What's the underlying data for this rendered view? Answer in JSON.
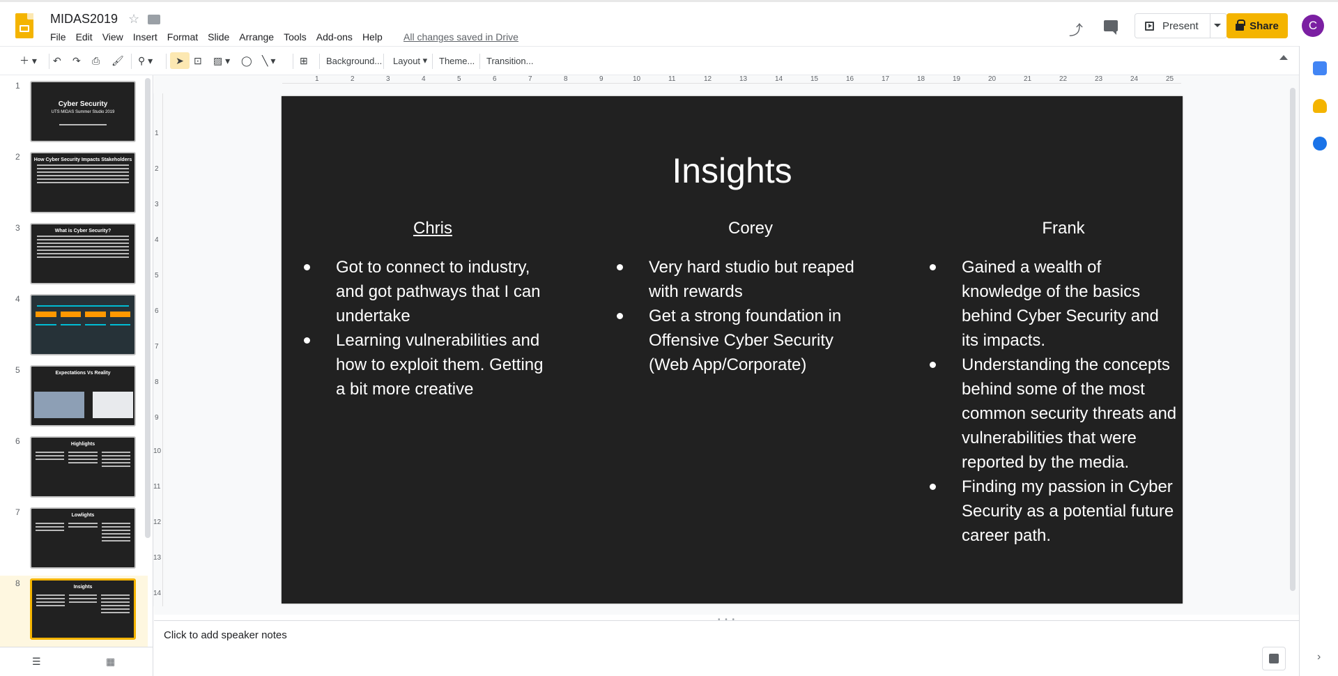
{
  "app": {
    "doc_title": "MIDAS2019",
    "save_status": "All changes saved in Drive",
    "menus": [
      "File",
      "Edit",
      "View",
      "Insert",
      "Format",
      "Slide",
      "Arrange",
      "Tools",
      "Add-ons",
      "Help"
    ],
    "present_label": "Present",
    "share_label": "Share",
    "avatar_letter": "C",
    "brand_color": "#f4b400"
  },
  "toolbar": {
    "background_label": "Background...",
    "layout_label": "Layout",
    "theme_label": "Theme...",
    "transition_label": "Transition...",
    "icons": [
      "new-slide-icon",
      "undo-icon",
      "redo-icon",
      "print-icon",
      "paint-format-icon",
      "zoom-icon",
      "select-icon",
      "textbox-icon",
      "image-icon",
      "shape-icon",
      "line-icon",
      "comment-add-icon"
    ]
  },
  "ruler": {
    "horizontal": [
      "1",
      "2",
      "3",
      "4",
      "5",
      "6",
      "7",
      "8",
      "9",
      "10",
      "11",
      "12",
      "13",
      "14",
      "15",
      "16",
      "17",
      "18",
      "19",
      "20",
      "21",
      "22",
      "23",
      "24",
      "25"
    ],
    "vertical": [
      "1",
      "2",
      "3",
      "4",
      "5",
      "6",
      "7",
      "8",
      "9",
      "10",
      "11",
      "12",
      "13",
      "14"
    ]
  },
  "thumbnails": [
    {
      "num": "1",
      "title": "Cyber Security",
      "subtitle": "UTS MIDAS Summer Studio 2019"
    },
    {
      "num": "2",
      "title": "How Cyber Security Impacts Stakeholders",
      "subtitle": ""
    },
    {
      "num": "3",
      "title": "What is Cyber Security?",
      "subtitle": ""
    },
    {
      "num": "4",
      "title": "",
      "subtitle": ""
    },
    {
      "num": "5",
      "title": "Expectations Vs Reality",
      "subtitle": ""
    },
    {
      "num": "6",
      "title": "Highlights",
      "subtitle": ""
    },
    {
      "num": "7",
      "title": "Lowlights",
      "subtitle": ""
    },
    {
      "num": "8",
      "title": "Insights",
      "subtitle": ""
    }
  ],
  "slide": {
    "title": "Insights",
    "columns": [
      {
        "heading": "Chris",
        "underline": true,
        "bullets": [
          "Got to connect to industry, and got pathways that I can undertake",
          "Learning vulnerabilities and how to exploit them. Getting a bit more creative"
        ]
      },
      {
        "heading": "Corey",
        "underline": false,
        "bullets": [
          "Very hard studio but reaped with rewards",
          "Get a strong foundation in Offensive Cyber Security (Web App/Corporate)"
        ]
      },
      {
        "heading": "Frank",
        "underline": false,
        "bullets": [
          "Gained a wealth of knowledge of the basics behind Cyber Security and its impacts.",
          "Understanding the concepts behind some of the most common security threats and vulnerabilities that were reported by the media.",
          "Finding my passion in Cyber Security as a potential future career path."
        ]
      }
    ]
  },
  "notes": {
    "placeholder": "Click to add speaker notes"
  }
}
